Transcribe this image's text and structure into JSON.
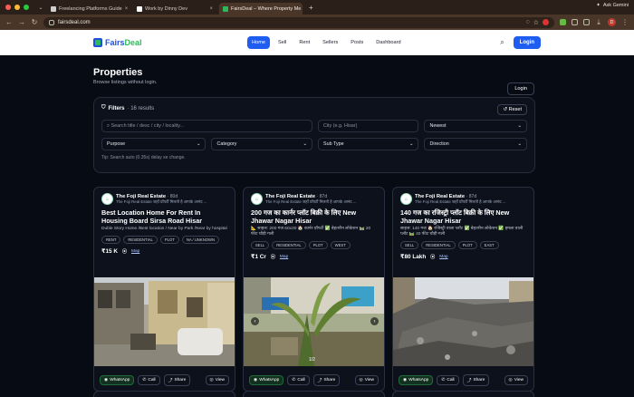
{
  "browser": {
    "tabs": [
      {
        "label": "Freelancing Platforms Guide"
      },
      {
        "label": "Work by Dinny Dev"
      },
      {
        "label": "FairsDeal – Where Property Me"
      }
    ],
    "new_tab": "+",
    "ask_gemini": "Ask Gemini",
    "url": "fairsdeal.com"
  },
  "site": {
    "logo_fairs": "Fairs",
    "logo_deal": "Deal",
    "nav": [
      "Home",
      "Sell",
      "Rent",
      "Sellers",
      "Posts",
      "Dashboard"
    ],
    "login_button": "Login"
  },
  "page": {
    "title": "Properties",
    "subtitle": "Browse listings without login.",
    "login_button": "Login"
  },
  "filters": {
    "label": "Filters",
    "count": "· 16 results",
    "reset": "Reset",
    "search_placeholder": "Search title / desc / city / locality...",
    "city_placeholder": "City (e.g. Hisar)",
    "sort": "Newest",
    "purpose": "Purpose",
    "category": "Category",
    "subtype": "Sub Type",
    "direction": "Direction",
    "tip": "Tip: Search auto (0.35s) delay se change."
  },
  "cards": [
    {
      "seller": "The Foji Real Estate",
      "ago": "· 80d",
      "seller_desc": "The Foji Real Estate जहाँ प्रॉपर्टी मिलती है आपके आनंद ...",
      "title": "Best Location Home For Rent In Housing Board Sirsa Road Hisar",
      "desc": "Duble Story Home /Best location / Near by Park /Near by hospital",
      "tags": [
        "RENT",
        "RESIDENTIAL",
        "PLOT",
        "NA / UNKNOWN"
      ],
      "price": "₹15 K",
      "map": "Map",
      "actions": {
        "whatsapp": "WhatsApp",
        "call": "Call",
        "share": "Share",
        "view": "View"
      }
    },
    {
      "seller": "The Foji Real Estate",
      "ago": "· 87d",
      "seller_desc": "The Foji Real Estate जहाँ प्रॉपर्टी मिलती है आपके आनंद ...",
      "title": "200 गज का कार्नर प्लॉट बिक्री के लिए New Jhawar Nagar Hisar",
      "desc": "📐 साइज: 200 गज 60x30 🏠 कार्नर प्रॉपर्टी ✅ बेहतरीन लोकेशन 🛤️ 20 फीट चौड़ी गली",
      "tags": [
        "SELL",
        "RESIDENTIAL",
        "PLOT",
        "WEST"
      ],
      "price": "₹1 Cr",
      "map": "Map",
      "slide": "1/2",
      "actions": {
        "whatsapp": "WhatsApp",
        "call": "Call",
        "share": "Share",
        "view": "View"
      }
    },
    {
      "seller": "The Foji Real Estate",
      "ago": "· 87d",
      "seller_desc": "The Foji Real Estate जहाँ प्रॉपर्टी मिलती है आपके आनंद ...",
      "title": "140 गज का रजिस्ट्री प्लॉट बिक्री के लिए New Jhawar Nagar Hisar",
      "desc": "साइज: 140 गज 🏠 रजिस्ट्री वाला प्लॉट ✅ बेहतरीन लोकेशन ✅ इमला वाली प्लॉट 🛤️ 40 फीट चौड़ी गली",
      "tags": [
        "SELL",
        "RESIDENTIAL",
        "PLOT",
        "EAST"
      ],
      "price": "₹80 Lakh",
      "map": "Map",
      "actions": {
        "whatsapp": "WhatsApp",
        "call": "Call",
        "share": "Share",
        "view": "View"
      }
    }
  ]
}
